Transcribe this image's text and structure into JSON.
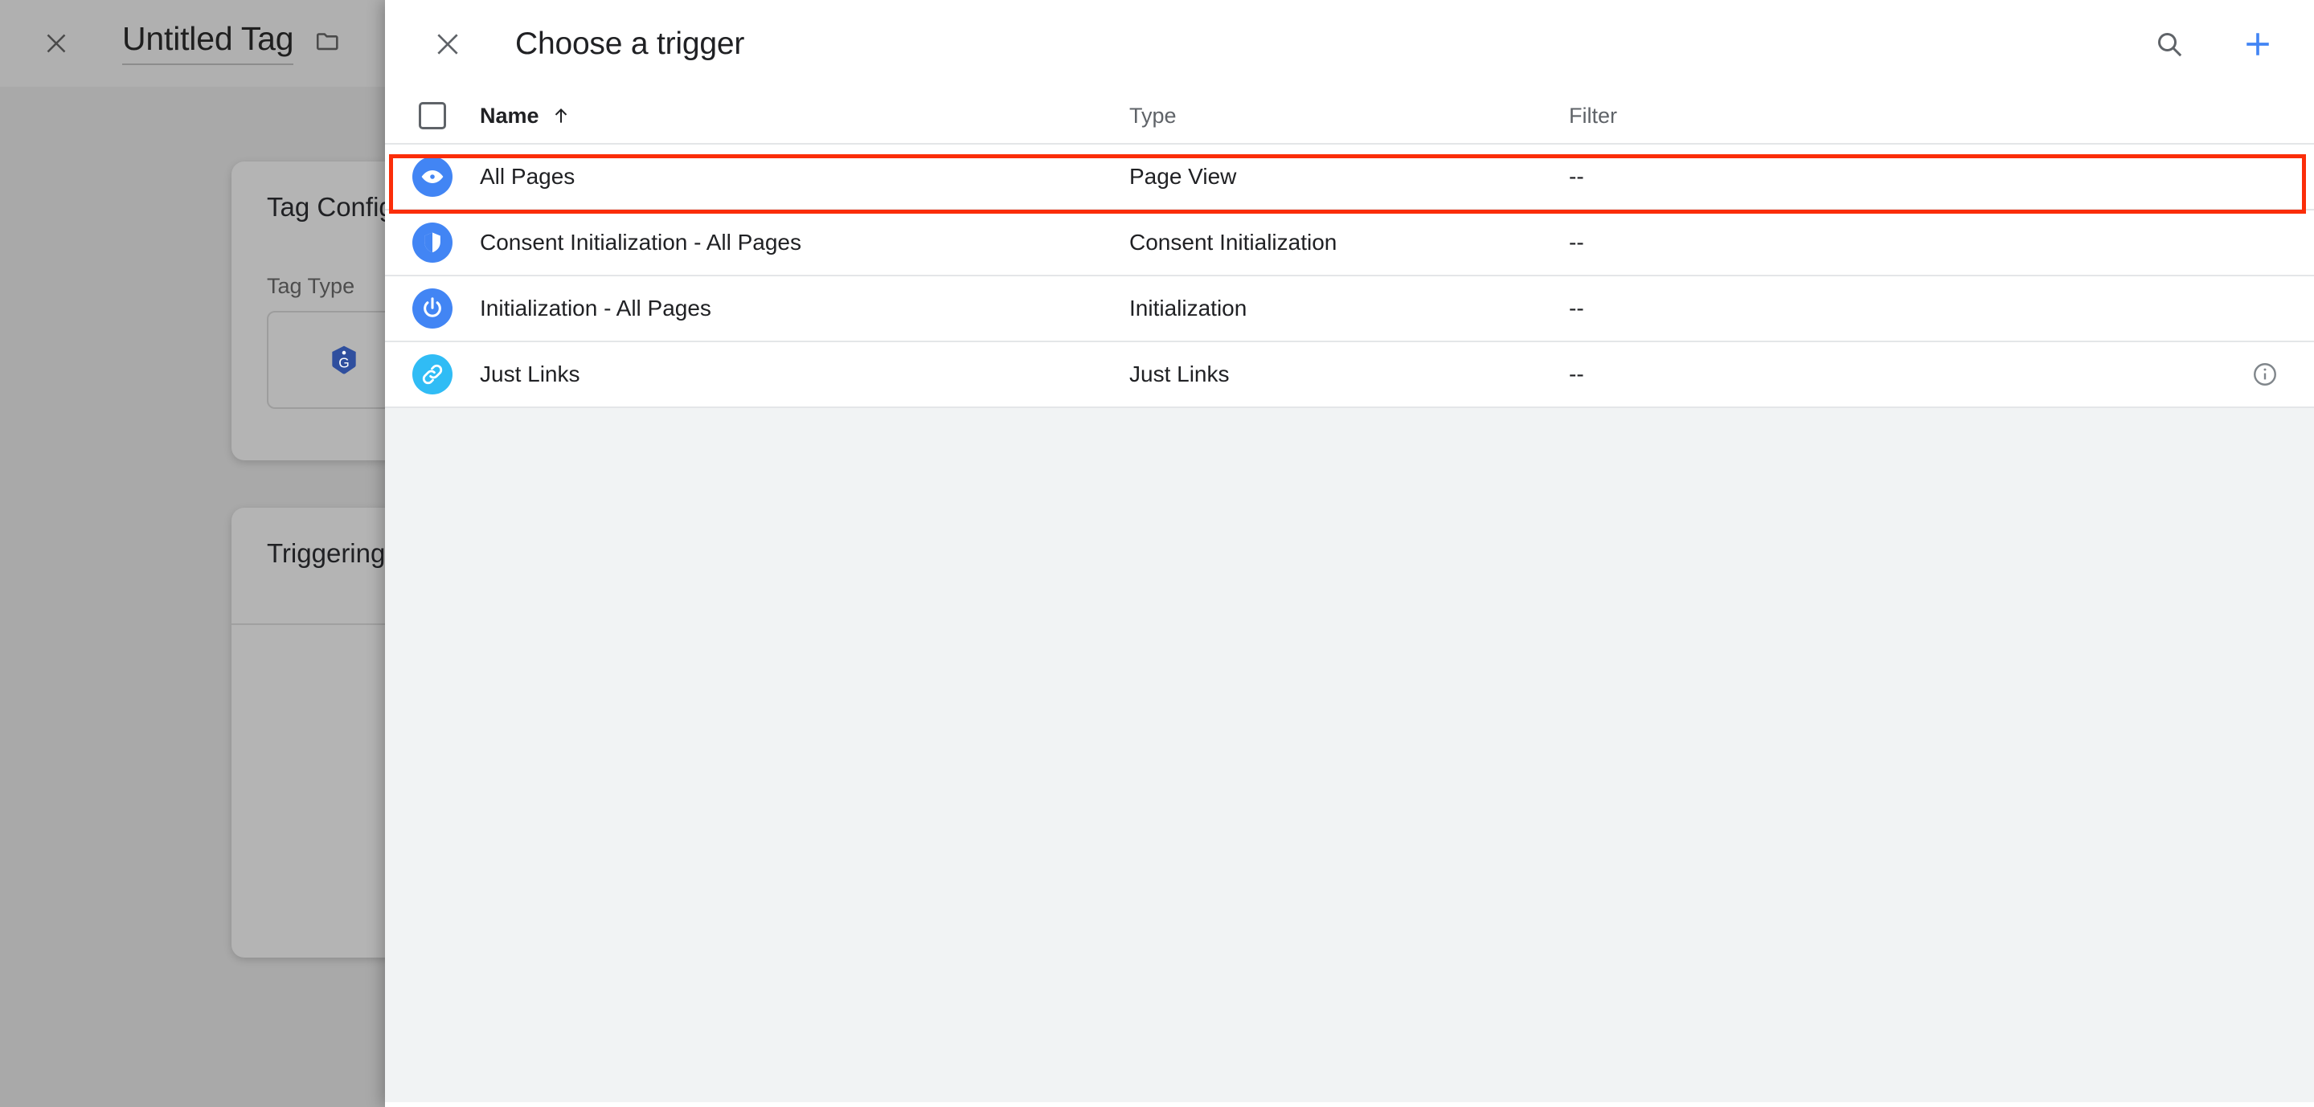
{
  "background": {
    "close_icon": "close-icon",
    "tag_title": "Untitled Tag",
    "folder_icon": "folder-icon",
    "cards": {
      "tag_configuration_title": "Tag Configuration",
      "tag_type_label": "Tag Type",
      "tag_type_icon": "google-tag-icon",
      "triggering_title": "Triggering"
    }
  },
  "modal": {
    "close_icon": "close-icon",
    "title": "Choose a trigger",
    "search_icon": "search-icon",
    "add_icon": "plus-icon",
    "table": {
      "select_all_checkbox": "select-all-checkbox",
      "columns": {
        "name": "Name",
        "sort_indicator": "↑",
        "type": "Type",
        "filter": "Filter"
      },
      "rows": [
        {
          "icon": "eye-icon",
          "icon_color": "#4285f4",
          "name": "All Pages",
          "type": "Page View",
          "filter": "--",
          "info": false,
          "highlighted": true
        },
        {
          "icon": "shield-icon",
          "icon_color": "#4285f4",
          "name": "Consent Initialization - All Pages",
          "type": "Consent Initialization",
          "filter": "--",
          "info": false,
          "highlighted": false
        },
        {
          "icon": "power-icon",
          "icon_color": "#4285f4",
          "name": "Initialization - All Pages",
          "type": "Initialization",
          "filter": "--",
          "info": false,
          "highlighted": false
        },
        {
          "icon": "link-icon",
          "icon_color": "#30bcf5",
          "name": "Just Links",
          "type": "Just Links",
          "filter": "--",
          "info": true,
          "highlighted": false
        }
      ]
    }
  },
  "annotation": {
    "highlight_color": "#fb2d09",
    "target": "All Pages row"
  }
}
